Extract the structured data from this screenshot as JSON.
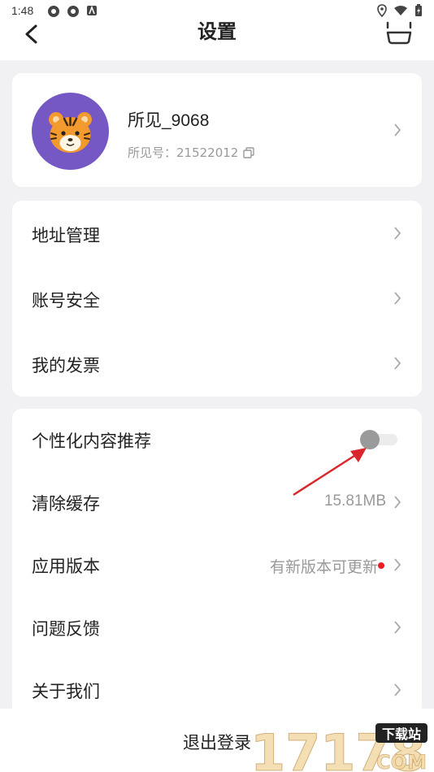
{
  "status_bar": {
    "time": "1:48"
  },
  "header": {
    "title": "设置"
  },
  "profile": {
    "name": "所见_9068",
    "id_label": "所见号：21522012"
  },
  "menu_group_1": [
    {
      "label": "地址管理"
    },
    {
      "label": "账号安全"
    },
    {
      "label": "我的发票"
    }
  ],
  "menu_group_2": {
    "personalized": {
      "label": "个性化内容推荐",
      "enabled": false
    },
    "clear_cache": {
      "label": "清除缓存",
      "value": "15.81MB"
    },
    "app_version": {
      "label": "应用版本",
      "value": "有新版本可更新"
    },
    "feedback": {
      "label": "问题反馈"
    },
    "about": {
      "label": "关于我们"
    }
  },
  "footer": {
    "logout_label": "退出登录"
  },
  "watermark": {
    "text": "17178",
    "sub": "下载站",
    "domain": "COM"
  },
  "colors": {
    "avatar_bg": "#7658c4",
    "red_dot": "#ee1c25",
    "arrow": "#d9262a"
  },
  "icons": [
    "back-arrow-icon",
    "basket-icon",
    "chevron-right-icon",
    "copy-icon",
    "location-icon",
    "wifi-icon",
    "battery-icon"
  ]
}
